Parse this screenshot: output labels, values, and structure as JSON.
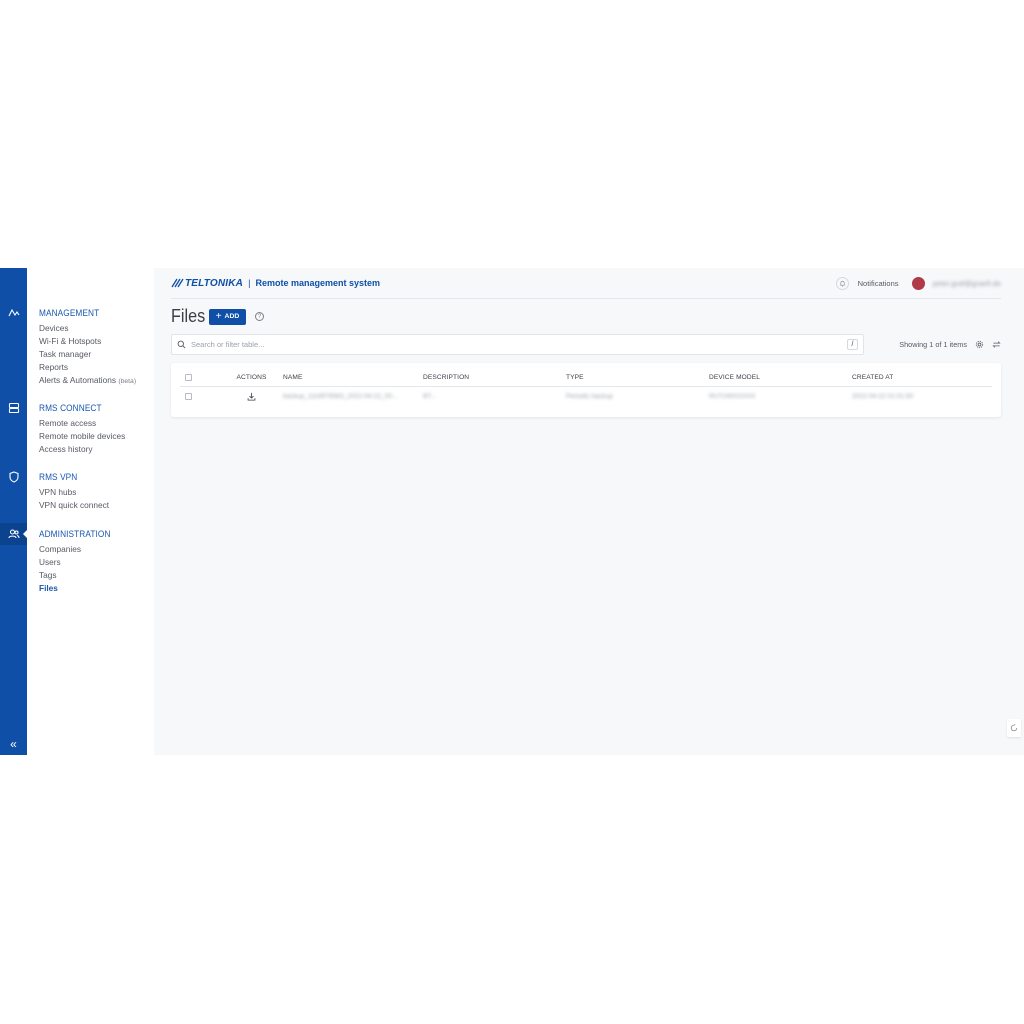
{
  "rail": {
    "icons": [
      "activity-icon",
      "server-icon",
      "shield-icon",
      "users-icon"
    ],
    "collapse_label": "«"
  },
  "sidebar": {
    "groups": [
      {
        "title": "MANAGEMENT",
        "items": [
          "Devices",
          "Wi-Fi & Hotspots",
          "Task manager",
          "Reports",
          "Alerts & Automations"
        ],
        "beta_label": "(beta)"
      },
      {
        "title": "RMS CONNECT",
        "items": [
          "Remote access",
          "Remote mobile devices",
          "Access history"
        ]
      },
      {
        "title": "RMS VPN",
        "items": [
          "VPN hubs",
          "VPN quick connect"
        ]
      },
      {
        "title": "ADMINISTRATION",
        "items": [
          "Companies",
          "Users",
          "Tags",
          "Files"
        ],
        "active": "Files"
      }
    ]
  },
  "header": {
    "brand": "TELTONIKA",
    "separator": "|",
    "app_title": "Remote management system",
    "notifications_label": "Notifications",
    "user_email": "peter.graf@graefi.de"
  },
  "page": {
    "title": "Files",
    "add_label": "ADD",
    "add_plus": "+",
    "help_glyph": "?"
  },
  "search": {
    "placeholder": "Search or filter table...",
    "shortcut": "/"
  },
  "table_info": {
    "showing": "Showing 1 of 1 items"
  },
  "table": {
    "columns": [
      "ACTIONS",
      "NAME",
      "DESCRIPTION",
      "TYPE",
      "DEVICE MODEL",
      "CREATED AT"
    ],
    "rows": [
      {
        "name": "backup_1118976563_2022-04-22_00...",
        "description": "BT...",
        "type": "Periodic backup",
        "device_model": "RUT240XXXXX",
        "created_at": "2022-04-22 01:01:50"
      }
    ]
  },
  "colors": {
    "brand": "#0f4fa8",
    "background": "#f7f8fa",
    "text": "#3a3f47"
  }
}
